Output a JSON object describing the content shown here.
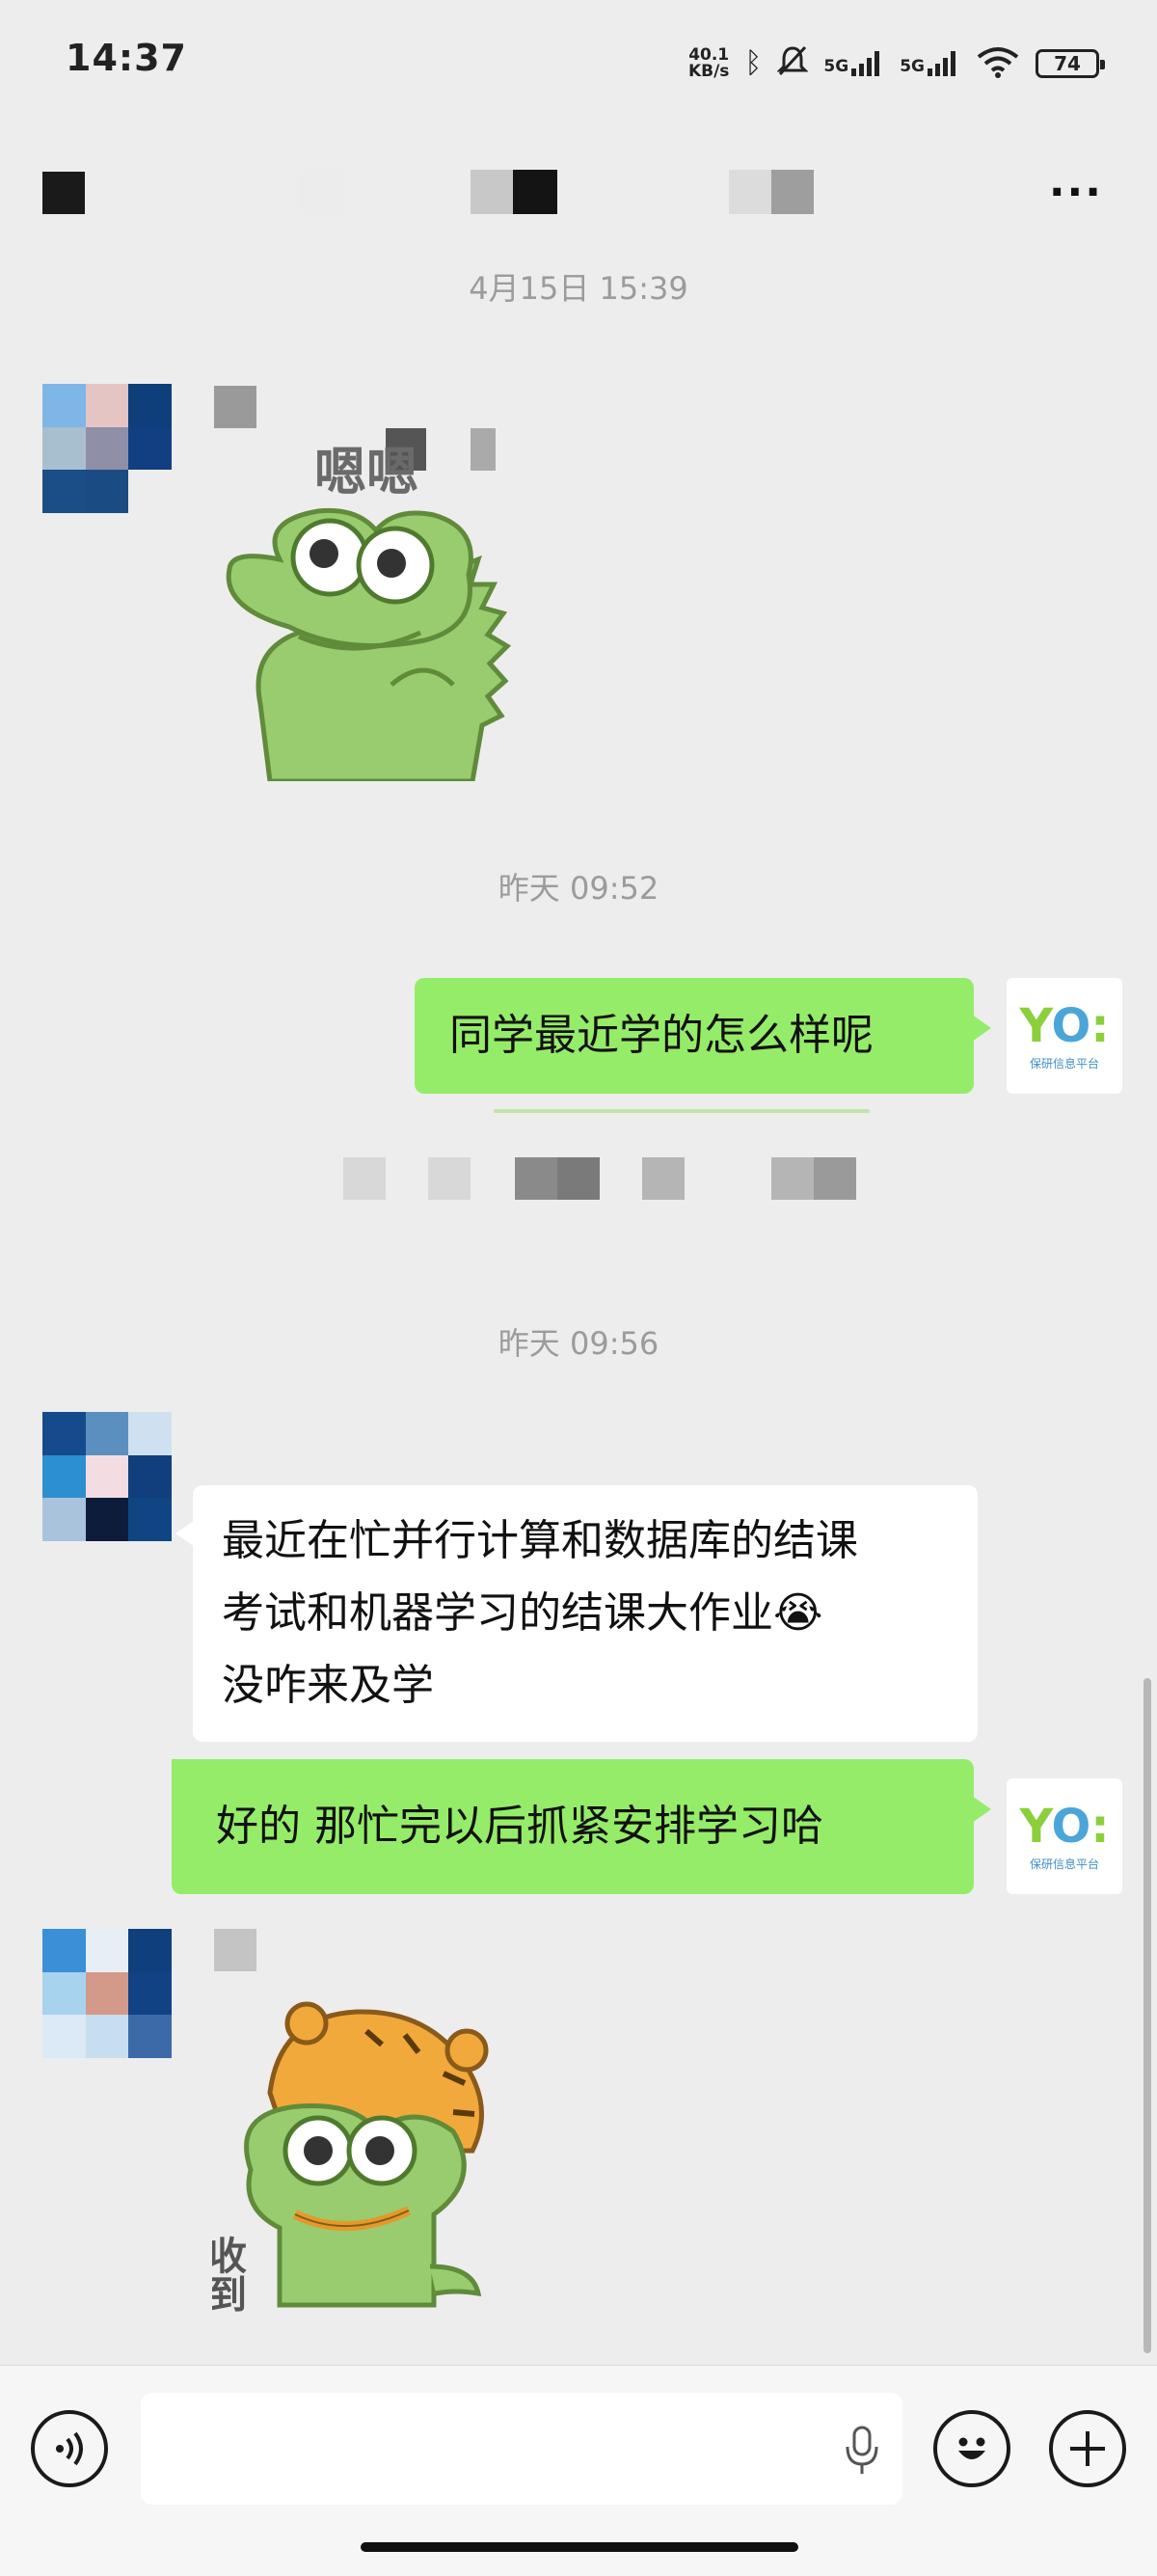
{
  "status_bar": {
    "time": "14:37",
    "net_speed": "40.1",
    "net_speed_unit": "KB/s",
    "sim1": "5G",
    "sim2": "5G",
    "battery": "74"
  },
  "header": {
    "more_label": "···"
  },
  "messages": [
    {
      "type": "timestamp",
      "text": "4月15日 15:39"
    },
    {
      "type": "sticker",
      "sender": "contact",
      "caption": "嗯嗯"
    },
    {
      "type": "timestamp",
      "text": "昨天 09:52"
    },
    {
      "type": "text",
      "sender": "me",
      "text": "同学最近学的怎么样呢"
    },
    {
      "type": "timestamp",
      "text": "昨天 09:56"
    },
    {
      "type": "text",
      "sender": "contact",
      "lines": [
        "最近在忙并行计算和数据库的结课",
        "考试和机器学习的结课大作业😭",
        "没咋来及学"
      ]
    },
    {
      "type": "text",
      "sender": "me",
      "text": "好的 那忙完以后抓紧安排学习哈"
    },
    {
      "type": "sticker",
      "sender": "contact",
      "caption": "收到"
    }
  ],
  "my_avatar": {
    "caption": "保研信息平台"
  },
  "input_bar": {
    "placeholder": ""
  },
  "colors": {
    "bubble_me": "#95ec69",
    "bubble_them": "#ffffff",
    "background": "#ededed"
  }
}
